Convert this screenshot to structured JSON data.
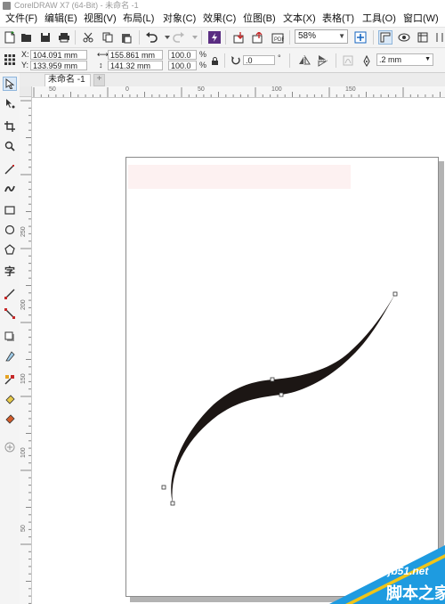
{
  "window": {
    "title": "CorelDRAW X7 (64-Bit) - 未命名 -1"
  },
  "menu": [
    {
      "name": "file",
      "label": "文件(F)"
    },
    {
      "name": "edit",
      "label": "编辑(E)"
    },
    {
      "name": "view",
      "label": "视图(V)"
    },
    {
      "name": "layout",
      "label": "布局(L)"
    },
    {
      "name": "object",
      "label": "对象(C)"
    },
    {
      "name": "effects",
      "label": "效果(C)"
    },
    {
      "name": "bitmaps",
      "label": "位图(B)"
    },
    {
      "name": "text",
      "label": "文本(X)"
    },
    {
      "name": "table",
      "label": "表格(T)"
    },
    {
      "name": "tools",
      "label": "工具(O)"
    },
    {
      "name": "window",
      "label": "窗口(W)"
    }
  ],
  "toolbar": {
    "zoom": "58%"
  },
  "property_bar": {
    "x": "104.091 mm",
    "y": "133.959 mm",
    "width": "155.861 mm",
    "height": "141.32 mm",
    "scale_x": "100.0",
    "scale_y": "100.0",
    "percent": "%",
    "rotation": ".0",
    "degree": "°",
    "outline": ".2 mm",
    "x_label": "X:",
    "y_label": "Y:"
  },
  "document": {
    "tab": "未命名 -1",
    "add_tab": "+"
  },
  "ruler": {
    "h": [
      {
        "label": "50"
      },
      {
        "label": "0"
      },
      {
        "label": "50"
      },
      {
        "label": "100"
      },
      {
        "label": "150"
      }
    ],
    "v": [
      {
        "label": "250"
      },
      {
        "label": "200"
      },
      {
        "label": "150"
      },
      {
        "label": "100"
      },
      {
        "label": "50"
      }
    ]
  },
  "watermark": {
    "site": "jb51.net",
    "name": "脚本之家"
  },
  "colors": {
    "curve_fill": "#1c1614",
    "page_border": "#8a8a8a",
    "watermark": "#1e9be0"
  }
}
